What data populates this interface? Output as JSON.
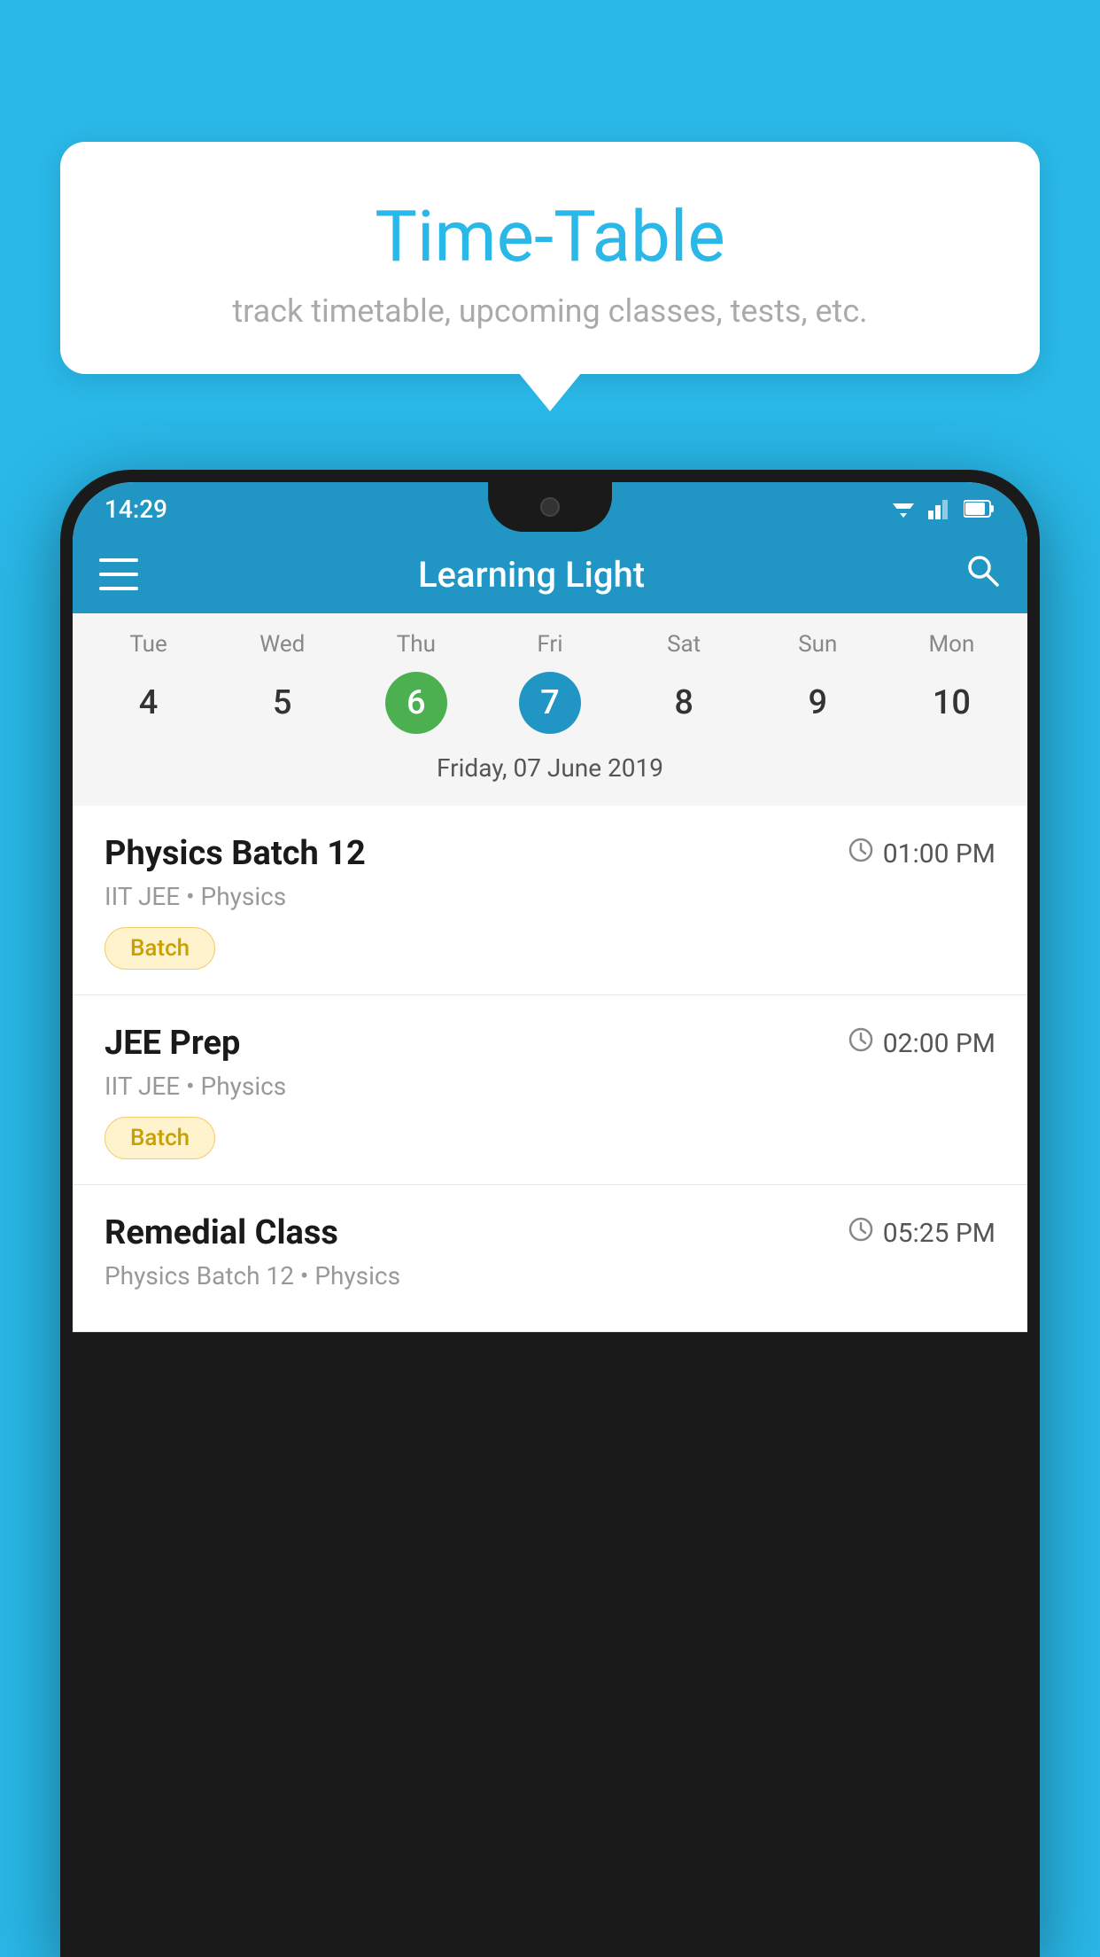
{
  "background_color": "#29b8e8",
  "tooltip": {
    "title": "Time-Table",
    "subtitle": "track timetable, upcoming classes, tests, etc."
  },
  "phone": {
    "status_bar": {
      "time": "14:29"
    },
    "app_bar": {
      "title": "Learning Light"
    },
    "calendar": {
      "day_names": [
        "Tue",
        "Wed",
        "Thu",
        "Fri",
        "Sat",
        "Sun",
        "Mon"
      ],
      "dates": [
        "4",
        "5",
        "6",
        "7",
        "8",
        "9",
        "10"
      ],
      "today_index": 2,
      "selected_index": 3,
      "selected_label": "Friday, 07 June 2019"
    },
    "schedule": [
      {
        "title": "Physics Batch 12",
        "time": "01:00 PM",
        "subtitle": "IIT JEE • Physics",
        "badge": "Batch"
      },
      {
        "title": "JEE Prep",
        "time": "02:00 PM",
        "subtitle": "IIT JEE • Physics",
        "badge": "Batch"
      },
      {
        "title": "Remedial Class",
        "time": "05:25 PM",
        "subtitle": "Physics Batch 12 • Physics",
        "badge": null
      }
    ]
  }
}
